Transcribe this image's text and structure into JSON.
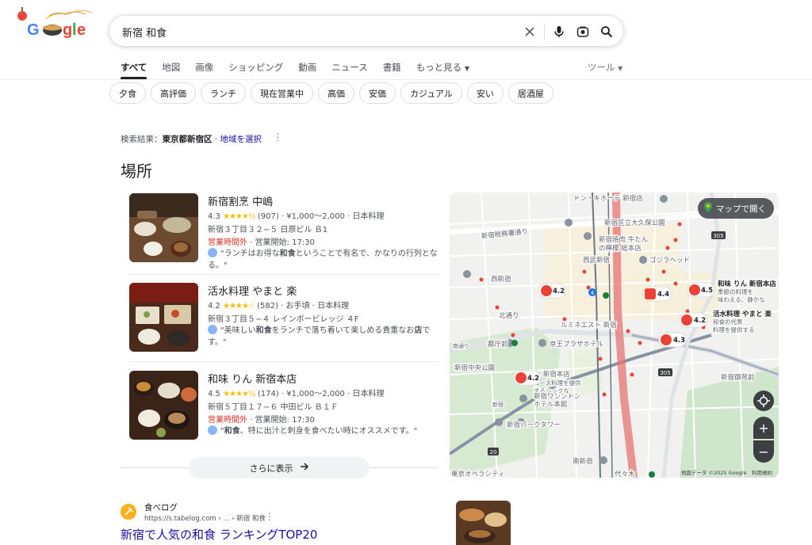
{
  "search": {
    "query": "新宿 和食"
  },
  "tabs": [
    {
      "label": "すべて",
      "active": true
    },
    {
      "label": "地図"
    },
    {
      "label": "画像"
    },
    {
      "label": "ショッピング"
    },
    {
      "label": "動画"
    },
    {
      "label": "ニュース"
    },
    {
      "label": "書籍"
    },
    {
      "label": "もっと見る"
    }
  ],
  "tools_label": "ツール",
  "chips": [
    "夕食",
    "高評価",
    "ランチ",
    "現在営業中",
    "高価",
    "安価",
    "カジュアル",
    "安い",
    "居酒屋"
  ],
  "location": {
    "prefix": "検索結果：",
    "place": "東京都新宿区",
    "sep": " · ",
    "link": "地域を選択"
  },
  "places_title": "場所",
  "listings": [
    {
      "name": "新宿割烹 中嶋",
      "rating": "4.3",
      "stars": "★★★★½",
      "reviews": "(907)",
      "price": "¥1,000〜2,000",
      "category": "日本料理",
      "address": "新宿３丁目３２−５ 日原ビル Ｂ1",
      "status": "営業時間外",
      "hours": "· 営業開始: 17:30",
      "review_pre": "\"ランチはお得な",
      "review_bold": "和食",
      "review_post": "ということで有名で、かなりの行列となる。\""
    },
    {
      "name": "活水料理 やまと 楽",
      "rating": "4.2",
      "stars": "★★★★☆",
      "reviews": "(582)",
      "price": "お手頃",
      "category": "日本料理",
      "address": "新宿３丁目５−４ レインボービレッジ ４F",
      "review_pre": "\"美味しい",
      "review_bold": "和食",
      "review_mid": "をランチで落ち着いて楽しめる貴重なお",
      "review_bold2": "店",
      "review_post": "です。\""
    },
    {
      "name": "和味 りん 新宿本店",
      "rating": "4.5",
      "stars": "★★★★½",
      "reviews": "(174)",
      "price": "¥1,000〜2,000",
      "category": "日本料理",
      "address": "新宿５丁目１７−６ 中田ビル Ｂ１Ｆ",
      "status": "営業時間外",
      "hours": "· 営業開始: 17:30",
      "review_pre": "\"",
      "review_bold": "和食",
      "review_post": "、特に出汁と刺身を食べたい時にオススメです。\""
    }
  ],
  "more_button": "さらに表示",
  "map": {
    "open_label": "マップで開く",
    "credit": "地図データ ©2025 Google　利用規約",
    "pins": [
      {
        "rating": "4.2"
      },
      {
        "rating": "4.4"
      },
      {
        "rating": "4.5"
      },
      {
        "rating": "4.2"
      },
      {
        "rating": "4.3"
      },
      {
        "rating": "4.2"
      }
    ],
    "labels": {
      "don": "ドン・キホーテ 新宿店",
      "okubo": "新宿区立大久保公園",
      "zeimusho": "新宿税務署通り",
      "yakiniku": "新宿焼肉 牛たん",
      "yakiniku2": "の檸檬 総本店",
      "nishi": "西武新宿",
      "gojira": "ゴジラヘッド",
      "nishishinjuku": "西新宿",
      "kitadori": "北通り",
      "lumine": "ルミネエスト 新宿",
      "tochomae": "都庁前",
      "keio": "京王プラザホテル",
      "chuokoen": "新宿中央公園",
      "higashiyama": "東山 新宿本店",
      "course": "コース料理を提供",
      "course2": "するシックな",
      "washington": "新宿ワシントン",
      "washington2": "ホテル本館",
      "park": "新宿パークタワー",
      "minami": "南新宿",
      "yoyogi": "代々木",
      "opera": "東京オペラシティ",
      "gyoen": "新宿御苑前",
      "warin": "和味 りん 新宿本店",
      "warin2": "季節の料理を",
      "warin3": "味わえる、静かな",
      "yamato": "活水料理 やまと 楽",
      "yamato2": "和食の代表",
      "yamato3": "料理を提供する",
      "road305a": "305",
      "road305b": "305",
      "road4": "4",
      "road20": "20",
      "shinjukulabel": "新宿",
      "minamidori": "南通り"
    }
  },
  "result": {
    "site": "食べログ",
    "url": "https://s.tabelog.com › ... › 新宿 和食",
    "title": "新宿で人気の和食 ランキングTOP20"
  }
}
